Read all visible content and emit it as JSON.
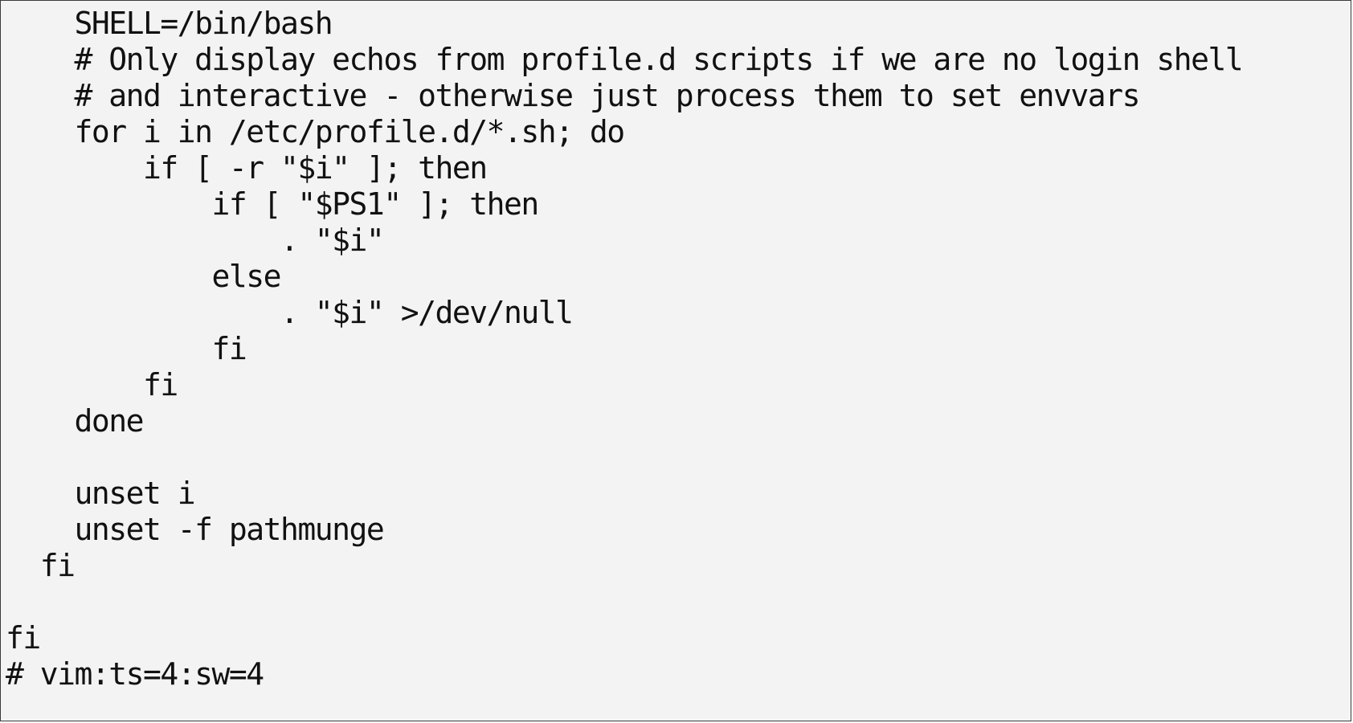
{
  "code": {
    "lines": [
      "    SHELL=/bin/bash",
      "    # Only display echos from profile.d scripts if we are no login shell",
      "    # and interactive - otherwise just process them to set envvars",
      "    for i in /etc/profile.d/*.sh; do",
      "        if [ -r \"$i\" ]; then",
      "            if [ \"$PS1\" ]; then",
      "                . \"$i\"",
      "            else",
      "                . \"$i\" >/dev/null",
      "            fi",
      "        fi",
      "    done",
      "",
      "    unset i",
      "    unset -f pathmunge",
      "  fi",
      "",
      "fi",
      "# vim:ts=4:sw=4"
    ]
  }
}
